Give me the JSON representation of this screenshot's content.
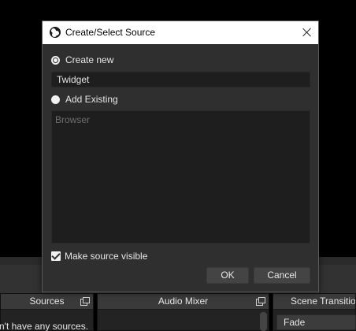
{
  "dialog": {
    "title": "Create/Select Source",
    "create_new_label": "Create new",
    "name_value": "Twidget",
    "add_existing_label": "Add Existing",
    "existing_sources": [
      "Browser"
    ],
    "make_visible_label": "Make source visible",
    "make_visible_checked": true,
    "selected_option": "Create new",
    "ok_label": "OK",
    "cancel_label": "Cancel"
  },
  "docks": {
    "sources": {
      "title": "Sources",
      "empty_text": "n't have any sources."
    },
    "audio_mixer": {
      "title": "Audio Mixer"
    },
    "scene_transitions": {
      "title": "Scene Transition",
      "selected": "Fade"
    }
  }
}
